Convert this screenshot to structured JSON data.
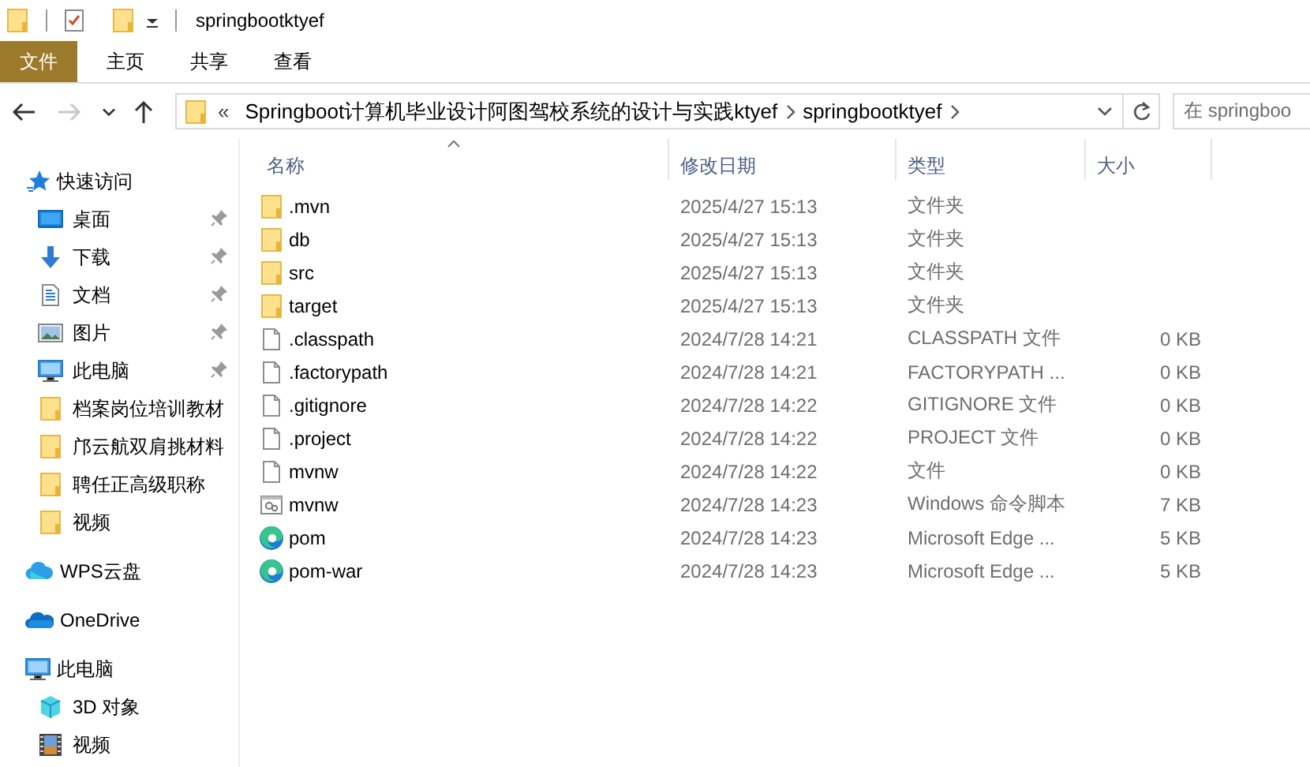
{
  "window": {
    "title": "springbootktyef"
  },
  "ribbon_tabs": [
    {
      "label": "文件",
      "selected": true
    },
    {
      "label": "主页",
      "selected": false
    },
    {
      "label": "共享",
      "selected": false
    },
    {
      "label": "查看",
      "selected": false
    }
  ],
  "nav_buttons": [
    {
      "kind": "back",
      "disabled": false
    },
    {
      "kind": "forward",
      "disabled": true
    },
    {
      "kind": "recent",
      "disabled": false
    },
    {
      "kind": "up",
      "disabled": false
    }
  ],
  "address_bar": {
    "overflow": "«",
    "crumbs": [
      "Springboot计算机毕业设计阿图驾校系统的设计与实践ktyef",
      "springbootktyef"
    ]
  },
  "search": {
    "placeholder": "在 springboo"
  },
  "sidebar": {
    "sections": [
      {
        "label": "快速访问",
        "kind": "star",
        "children": [
          {
            "label": "桌面",
            "kind": "desktop",
            "pinned": true
          },
          {
            "label": "下载",
            "kind": "download",
            "pinned": true
          },
          {
            "label": "文档",
            "kind": "document",
            "pinned": true
          },
          {
            "label": "图片",
            "kind": "picture",
            "pinned": true
          },
          {
            "label": "此电脑",
            "kind": "computer",
            "pinned": true
          },
          {
            "label": "档案岗位培训教材",
            "kind": "folder",
            "pinned": false
          },
          {
            "label": "邝云航双肩挑材料",
            "kind": "folder",
            "pinned": false
          },
          {
            "label": "聘任正高级职称",
            "kind": "folder",
            "pinned": false
          },
          {
            "label": "视频",
            "kind": "folder",
            "pinned": false
          }
        ]
      },
      {
        "label": "WPS云盘",
        "kind": "wps"
      },
      {
        "label": "OneDrive",
        "kind": "onedrive"
      },
      {
        "label": "此电脑",
        "kind": "computer",
        "children": [
          {
            "label": "3D 对象",
            "kind": "cube"
          },
          {
            "label": "视频",
            "kind": "video"
          }
        ]
      }
    ]
  },
  "file_list": {
    "columns": [
      {
        "label": "名称",
        "sorted": true
      },
      {
        "label": "修改日期",
        "sorted": false
      },
      {
        "label": "类型",
        "sorted": false
      },
      {
        "label": "大小",
        "sorted": false
      }
    ],
    "rows": [
      {
        "name": ".mvn",
        "kind": "folder",
        "modified": "2025/4/27 15:13",
        "type": "文件夹",
        "size": ""
      },
      {
        "name": "db",
        "kind": "folder",
        "modified": "2025/4/27 15:13",
        "type": "文件夹",
        "size": ""
      },
      {
        "name": "src",
        "kind": "folder",
        "modified": "2025/4/27 15:13",
        "type": "文件夹",
        "size": ""
      },
      {
        "name": "target",
        "kind": "folder",
        "modified": "2025/4/27 15:13",
        "type": "文件夹",
        "size": ""
      },
      {
        "name": ".classpath",
        "kind": "file",
        "modified": "2024/7/28 14:21",
        "type": "CLASSPATH 文件",
        "size": "0 KB"
      },
      {
        "name": ".factorypath",
        "kind": "file",
        "modified": "2024/7/28 14:21",
        "type": "FACTORYPATH ...",
        "size": "0 KB"
      },
      {
        "name": ".gitignore",
        "kind": "file",
        "modified": "2024/7/28 14:22",
        "type": "GITIGNORE 文件",
        "size": "0 KB"
      },
      {
        "name": ".project",
        "kind": "file",
        "modified": "2024/7/28 14:22",
        "type": "PROJECT 文件",
        "size": "0 KB"
      },
      {
        "name": "mvnw",
        "kind": "file",
        "modified": "2024/7/28 14:22",
        "type": "文件",
        "size": "0 KB"
      },
      {
        "name": "mvnw",
        "kind": "script",
        "modified": "2024/7/28 14:23",
        "type": "Windows 命令脚本",
        "size": "7 KB"
      },
      {
        "name": "pom",
        "kind": "edge",
        "modified": "2024/7/28 14:23",
        "type": "Microsoft Edge ...",
        "size": "5 KB"
      },
      {
        "name": "pom-war",
        "kind": "edge",
        "modified": "2024/7/28 14:23",
        "type": "Microsoft Edge ...",
        "size": "5 KB"
      }
    ]
  }
}
